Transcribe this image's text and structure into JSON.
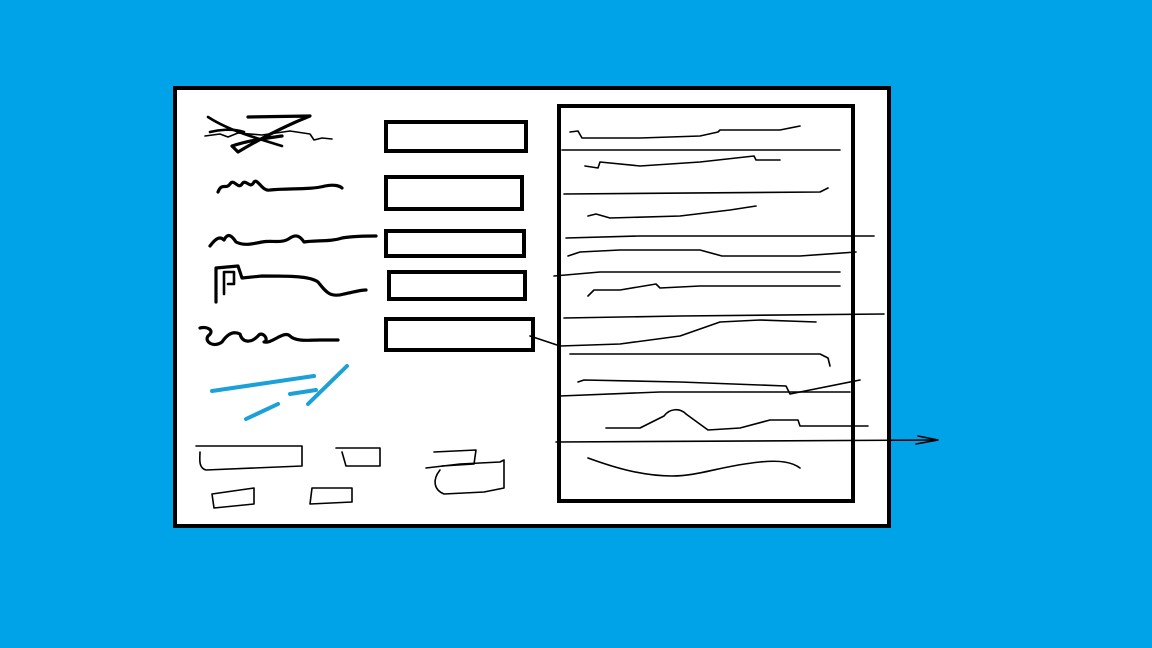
{
  "colors": {
    "background": "#00a2e8",
    "window": "#ffffff",
    "ink": "#000000",
    "accent": "#00a2e8"
  },
  "sketch": {
    "description_visible_text": "",
    "form_field_count": 5,
    "list_line_count": 14
  }
}
